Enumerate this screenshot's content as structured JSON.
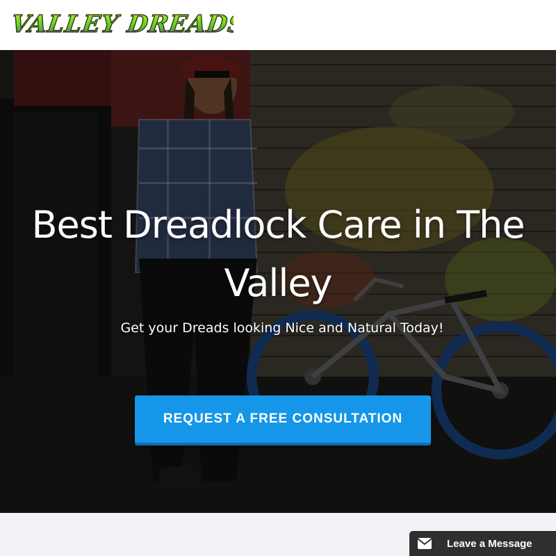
{
  "header": {
    "logo_text": "VALLEY DREADS"
  },
  "hero": {
    "title": "Best Dreadlock Care in The Valley",
    "subtitle": "Get your Dreads looking Nice and Natural Today!",
    "cta_label": "REQUEST A FREE CONSULTATION",
    "background_image": "man-with-dreadlocks-and-bmx-bike-photo"
  },
  "chat_widget": {
    "label": "Leave a Message",
    "icon": "envelope-icon"
  },
  "colors": {
    "cta": "#1596e8",
    "chat_tab": "#2f2f2f",
    "logo_green": "#7fd321",
    "logo_purple": "#8a2be2"
  }
}
